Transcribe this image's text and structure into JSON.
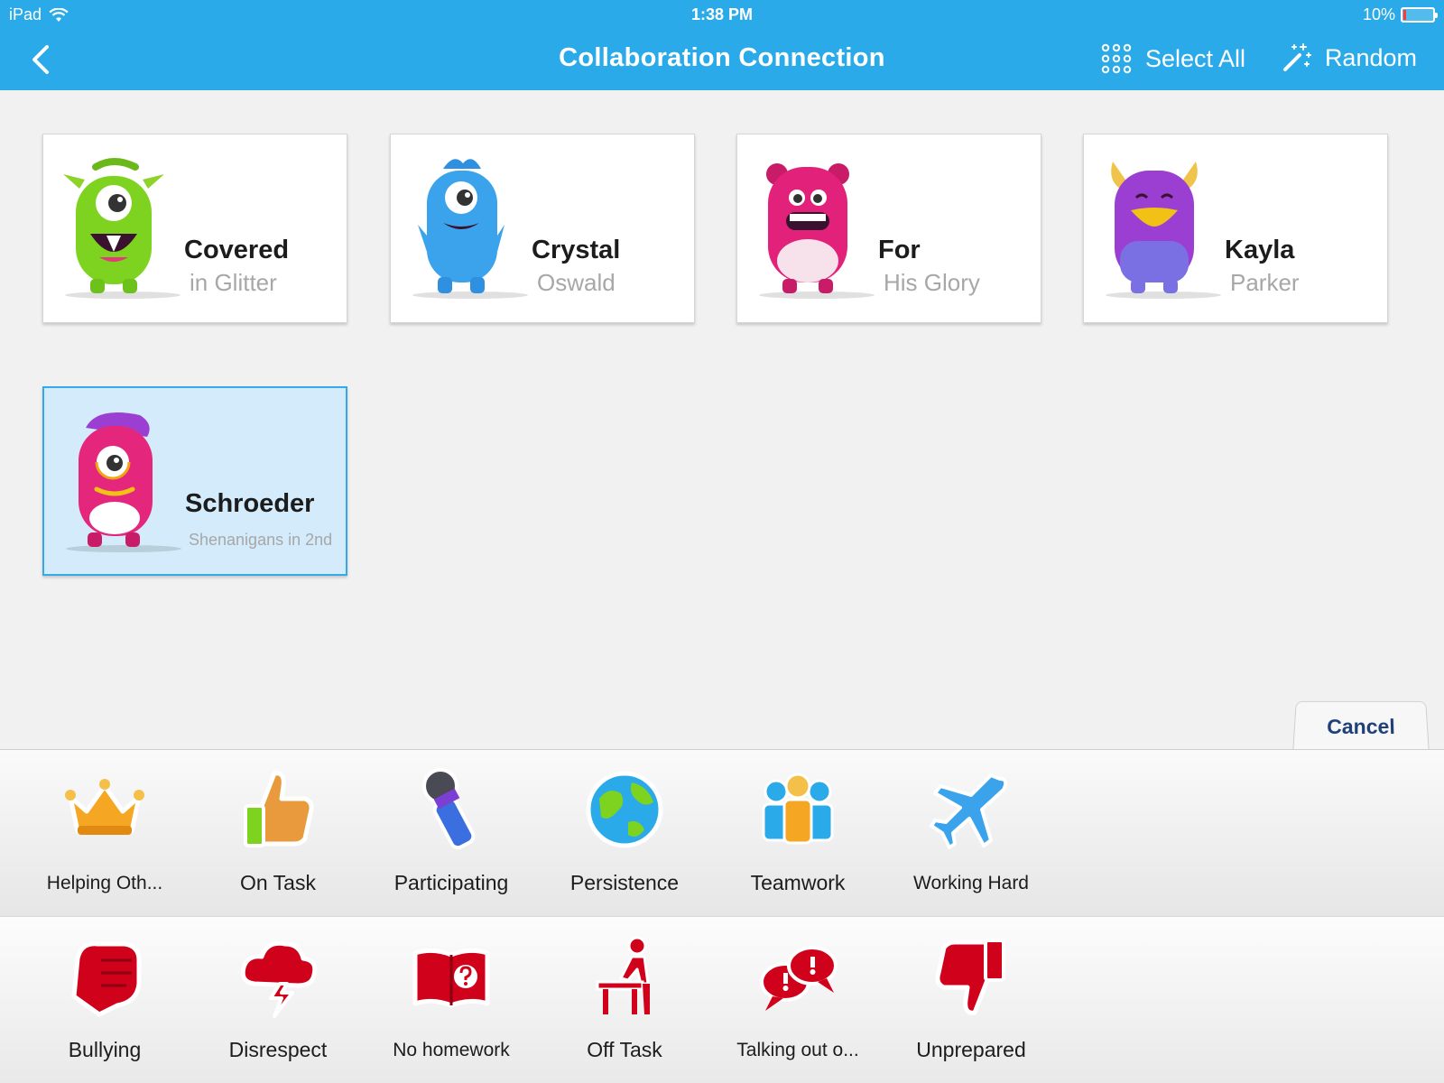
{
  "status": {
    "device": "iPad",
    "time": "1:38 PM",
    "battery": "10%",
    "battery_level": 0.1
  },
  "nav": {
    "title": "Collaboration Connection",
    "select_all": "Select All",
    "random": "Random"
  },
  "students": [
    {
      "first": "Covered",
      "last": "in Glitter",
      "color": "#7fd322",
      "selected": false
    },
    {
      "first": "Crystal",
      "last": "Oswald",
      "color": "#3aa3ec",
      "selected": false
    },
    {
      "first": "For",
      "last": "His Glory",
      "color": "#e2227a",
      "selected": false
    },
    {
      "first": "Kayla",
      "last": "Parker",
      "color": "#9b3fd3",
      "selected": false
    },
    {
      "first": "Schroeder",
      "last": "Shenanigans in 2nd",
      "color": "#e4277d",
      "selected": true
    }
  ],
  "cancel": "Cancel",
  "positive_skills": [
    {
      "label": "Helping Oth...",
      "icon": "crown-icon"
    },
    {
      "label": "On Task",
      "icon": "thumbs-up-icon"
    },
    {
      "label": "Participating",
      "icon": "microphone-icon"
    },
    {
      "label": "Persistence",
      "icon": "globe-icon"
    },
    {
      "label": "Teamwork",
      "icon": "team-icon"
    },
    {
      "label": "Working Hard",
      "icon": "airplane-icon"
    }
  ],
  "negative_skills": [
    {
      "label": "Bullying",
      "icon": "fist-icon"
    },
    {
      "label": "Disrespect",
      "icon": "storm-cloud-icon"
    },
    {
      "label": "No homework",
      "icon": "question-book-icon"
    },
    {
      "label": "Off Task",
      "icon": "desk-person-icon"
    },
    {
      "label": "Talking out o...",
      "icon": "speech-bubbles-icon"
    },
    {
      "label": "Unprepared",
      "icon": "thumbs-down-icon"
    }
  ]
}
